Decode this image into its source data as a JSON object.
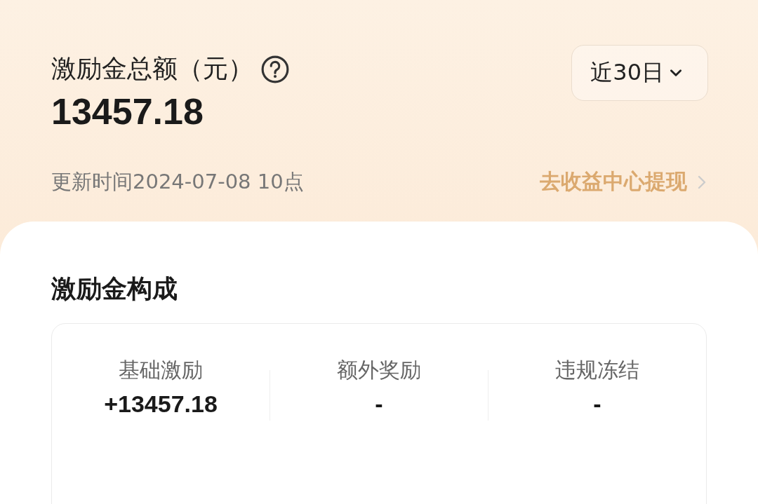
{
  "header": {
    "title": "激励金总额（元）",
    "total": "13457.18",
    "period": "近30日",
    "updated": "更新时间2024-07-08 10点",
    "withdraw_link": "去收益中心提现"
  },
  "composition": {
    "title": "激励金构成",
    "items": [
      {
        "label": "基础激励",
        "value": "+13457.18"
      },
      {
        "label": "额外奖励",
        "value": "-"
      },
      {
        "label": "违规冻结",
        "value": "-"
      }
    ]
  }
}
